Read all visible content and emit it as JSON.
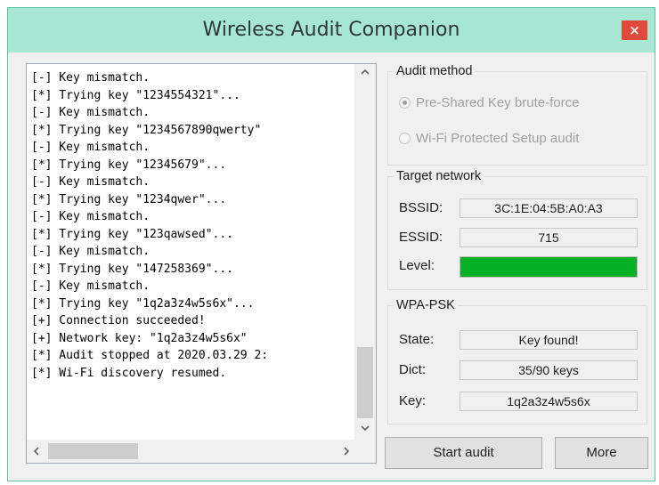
{
  "window": {
    "title": "Wireless Audit Companion",
    "close_glyph": "×"
  },
  "log": {
    "lines": [
      "[-] Key mismatch.",
      "[*] Trying key \"1234554321\"...",
      "[-] Key mismatch.",
      "[*] Trying key \"1234567890qwerty\"",
      "[-] Key mismatch.",
      "[*] Trying key \"12345679\"...",
      "[-] Key mismatch.",
      "[*] Trying key \"1234qwer\"...",
      "[-] Key mismatch.",
      "[*] Trying key \"123qawsed\"...",
      "[-] Key mismatch.",
      "[*] Trying key \"147258369\"...",
      "[-] Key mismatch.",
      "[*] Trying key \"1q2a3z4w5s6x\"...",
      "[+] Connection succeeded!",
      "[+] Network key: \"1q2a3z4w5s6x\"",
      "[*] Audit stopped at 2020.03.29 2:",
      "[*] Wi-Fi discovery resumed."
    ],
    "scroll_up_icon": "chevron-up-icon",
    "scroll_down_icon": "chevron-down-icon",
    "scroll_left_icon": "chevron-left-icon",
    "scroll_right_icon": "chevron-right-icon"
  },
  "audit_method": {
    "label": "Audit method",
    "options": [
      {
        "label": "Pre-Shared Key brute-force",
        "selected": true,
        "enabled": false
      },
      {
        "label": "Wi-Fi Protected Setup audit",
        "selected": false,
        "enabled": false
      }
    ]
  },
  "target_network": {
    "label": "Target network",
    "bssid_label": "BSSID:",
    "bssid_value": "3C:1E:04:5B:A0:A3",
    "essid_label": "ESSID:",
    "essid_value": "715",
    "level_label": "Level:",
    "level_fraction": 1.0,
    "level_color": "#06b025"
  },
  "wpa_psk": {
    "label": "WPA-PSK",
    "state_label": "State:",
    "state_value": "Key found!",
    "dict_label": "Dict:",
    "dict_value": "35/90 keys",
    "key_label": "Key:",
    "key_value": "1q2a3z4w5s6x"
  },
  "buttons": {
    "start_audit": "Start audit",
    "more": "More"
  },
  "colors": {
    "titlebar": "#a8e6d4",
    "close_button": "#e04a3a"
  }
}
